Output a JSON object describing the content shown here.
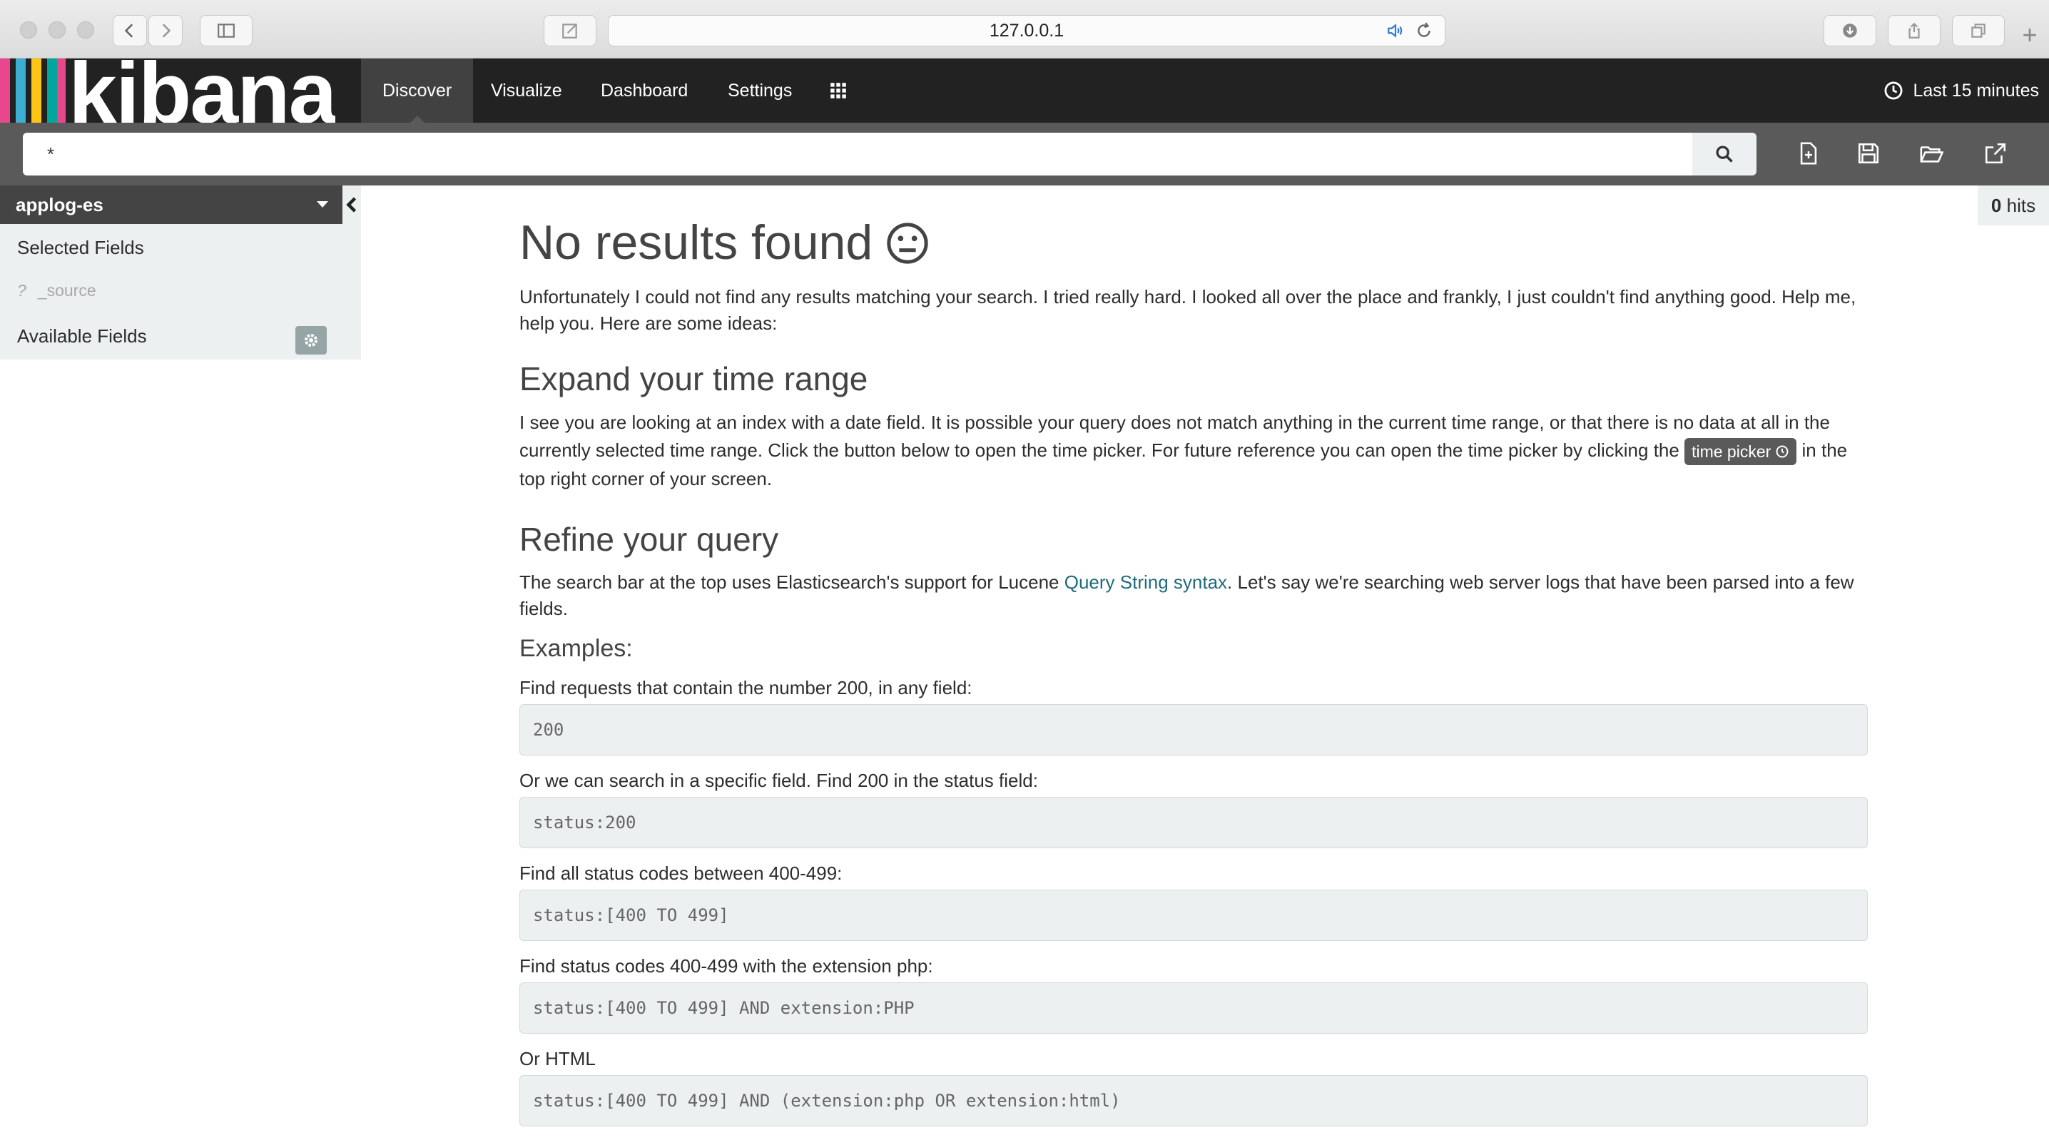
{
  "browser": {
    "url": "127.0.0.1"
  },
  "navbar": {
    "brand": "kibana",
    "tabs": [
      {
        "label": "Discover",
        "active": true
      },
      {
        "label": "Visualize",
        "active": false
      },
      {
        "label": "Dashboard",
        "active": false
      },
      {
        "label": "Settings",
        "active": false
      }
    ],
    "time_range": "Last 15 minutes",
    "stripe_colors": [
      "#e8488b",
      "#3caed2",
      "#fec514",
      "#00a69b",
      "#e8488b"
    ]
  },
  "query": {
    "value": "*"
  },
  "sidebar": {
    "index_pattern": "applog-es",
    "selected_fields_label": "Selected Fields",
    "source_field_type": "?",
    "source_field": "_source",
    "available_fields_label": "Available Fields"
  },
  "hits": {
    "count": "0",
    "label": "hits"
  },
  "main": {
    "title": "No results found",
    "intro": "Unfortunately I could not find any results matching your search. I tried really hard. I looked all over the place and frankly, I just couldn't find anything good. Help me, help you. Here are some ideas:",
    "time_heading": "Expand your time range",
    "time_text_before": "I see you are looking at an index with a date field. It is possible your query does not match anything in the current time range, or that there is no data at all in the currently selected time range. Click the button below to open the time picker. For future reference you can open the time picker by clicking the",
    "time_picker_chip": "time picker",
    "time_text_after": "in the top right corner of your screen.",
    "refine_heading": "Refine your query",
    "refine_text_before": "The search bar at the top uses Elasticsearch's support for Lucene",
    "refine_link": "Query String syntax",
    "refine_text_after": ". Let's say we're searching web server logs that have been parsed into a few fields.",
    "examples_heading": "Examples:",
    "examples": [
      {
        "label": "Find requests that contain the number 200, in any field:",
        "code": "200"
      },
      {
        "label": "Or we can search in a specific field. Find 200 in the status field:",
        "code": "status:200"
      },
      {
        "label": "Find all status codes between 400-499:",
        "code": "status:[400 TO 499]"
      },
      {
        "label": "Find status codes 400-499 with the extension php:",
        "code": "status:[400 TO 499] AND extension:PHP"
      },
      {
        "label": "Or HTML",
        "code": "status:[400 TO 499] AND (extension:php OR extension:html)"
      }
    ]
  }
}
